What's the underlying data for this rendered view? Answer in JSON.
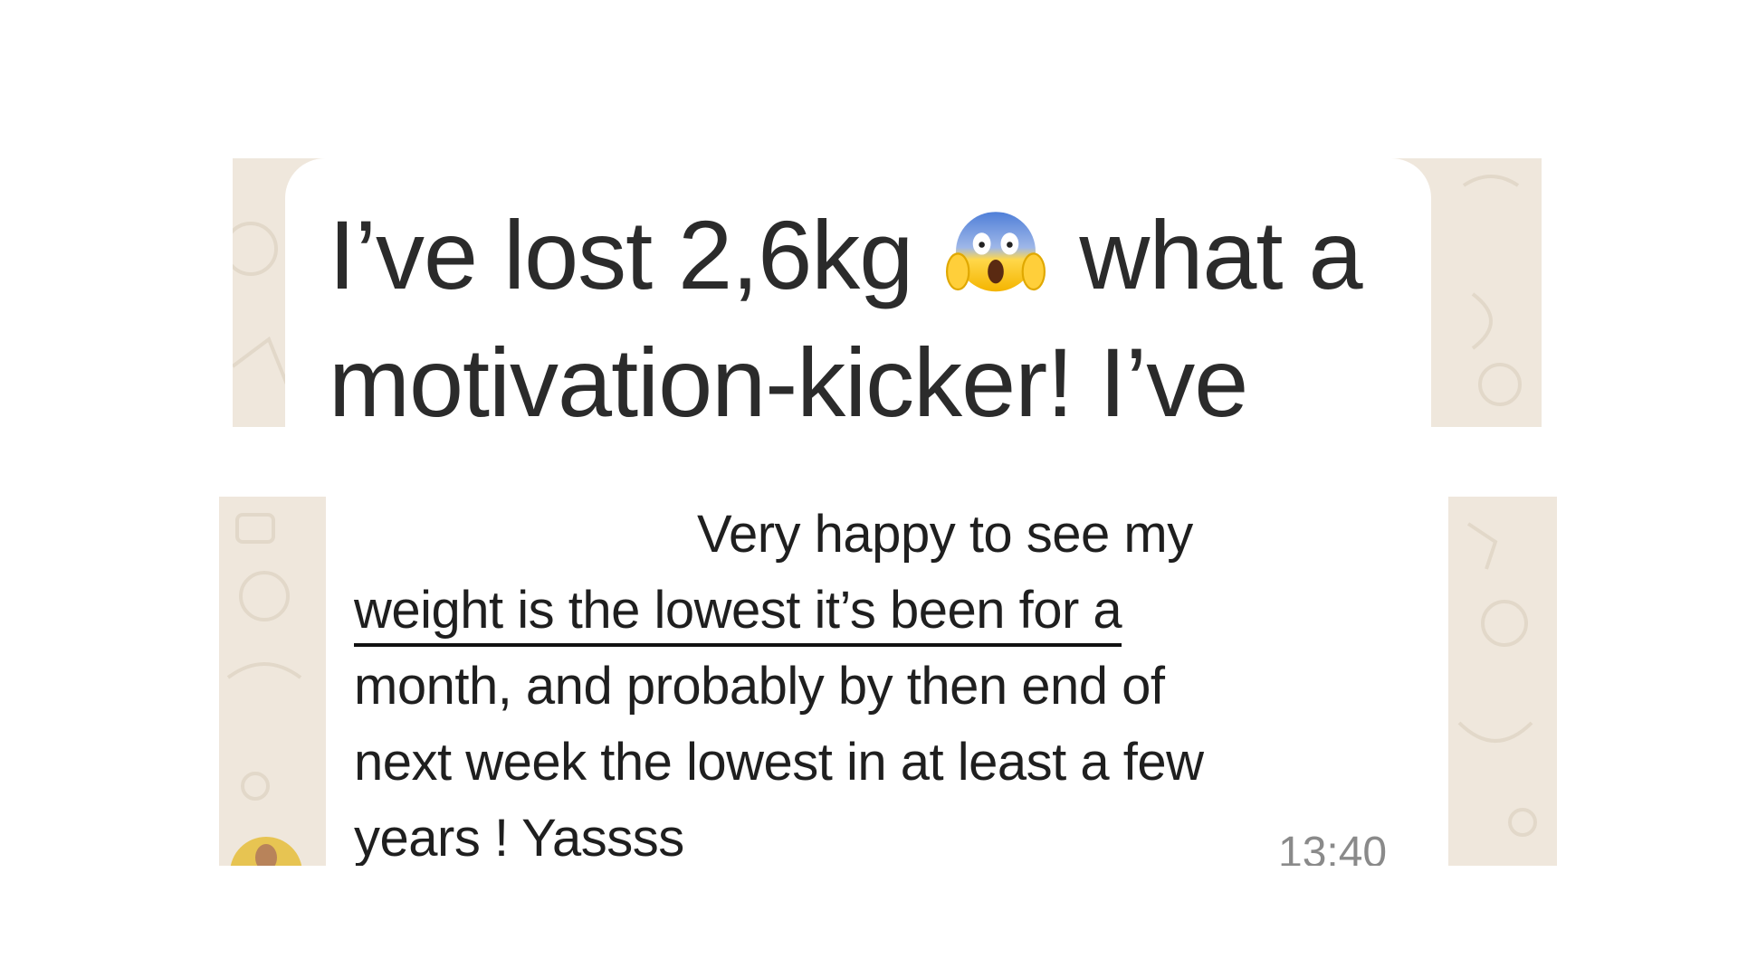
{
  "messages": [
    {
      "line_1": "I’ve lost 2,6kg",
      "emoji": "face-screaming-in-fear",
      "line_1_end": "what a",
      "line_2": "motivation-kicker! I’ve"
    },
    {
      "line_1": "Very happy to see my",
      "line_2": "weight is the lowest it’s been for a",
      "line_3": "month, and probably by then end of",
      "line_4": "next week the lowest in at least a few",
      "line_5": "years ! Yassss",
      "time": "13:40"
    }
  ],
  "colors": {
    "wallpaper": "#efe7dc",
    "bubble": "#ffffff",
    "text": "#1f1f1f",
    "timestamp": "#8a8a8a"
  }
}
